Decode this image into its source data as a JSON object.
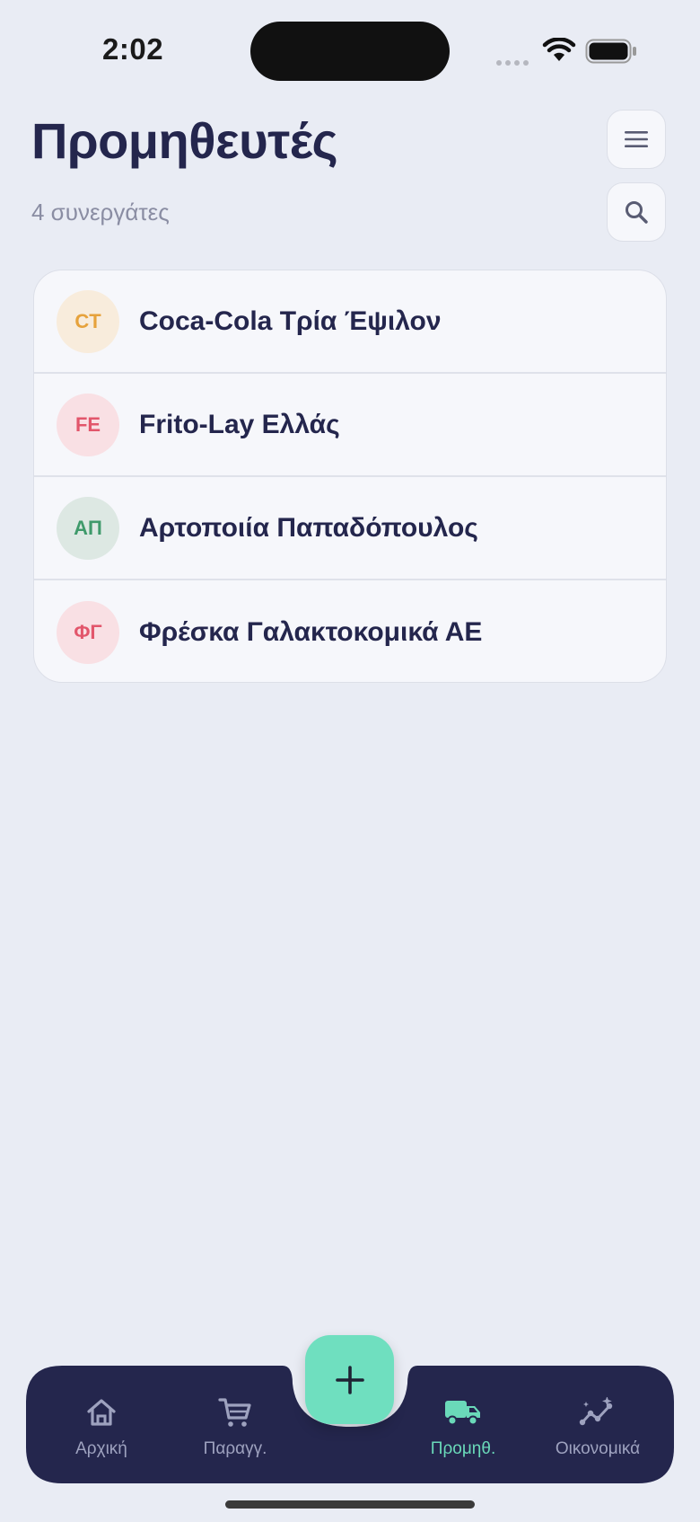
{
  "status_bar": {
    "time": "2:02"
  },
  "header": {
    "title": "Προμηθευτές",
    "subtitle": "4 συνεργάτες",
    "menu_icon": "hamburger-menu-icon",
    "search_icon": "search-icon"
  },
  "suppliers": [
    {
      "initials": "CT",
      "name": "Coca-Cola Τρία Έψιλον",
      "avatar_bg": "#f8ecdc",
      "avatar_fg": "#e6a23c"
    },
    {
      "initials": "FE",
      "name": "Frito-Lay Ελλάς",
      "avatar_bg": "#f9e0e4",
      "avatar_fg": "#e2566b"
    },
    {
      "initials": "ΑΠ",
      "name": "Αρτοποιία Παπαδόπουλος",
      "avatar_bg": "#dde8e3",
      "avatar_fg": "#3f9a6b"
    },
    {
      "initials": "ΦΓ",
      "name": "Φρέσκα Γαλακτοκομικά ΑΕ",
      "avatar_bg": "#f9e0e4",
      "avatar_fg": "#e2566b"
    }
  ],
  "tab_bar": {
    "tabs": [
      {
        "label": "Αρχική",
        "icon": "home-icon",
        "active": false
      },
      {
        "label": "Παραγγ.",
        "icon": "cart-icon",
        "active": false
      },
      {
        "label": "Προμηθ.",
        "icon": "truck-icon",
        "active": true
      },
      {
        "label": "Οικονομικά",
        "icon": "analytics-icon",
        "active": false
      }
    ],
    "fab_icon": "plus-icon"
  },
  "colors": {
    "background": "#e9ecf4",
    "tab_bar": "#24264d",
    "accent": "#6fdfbf",
    "title": "#24264d"
  }
}
